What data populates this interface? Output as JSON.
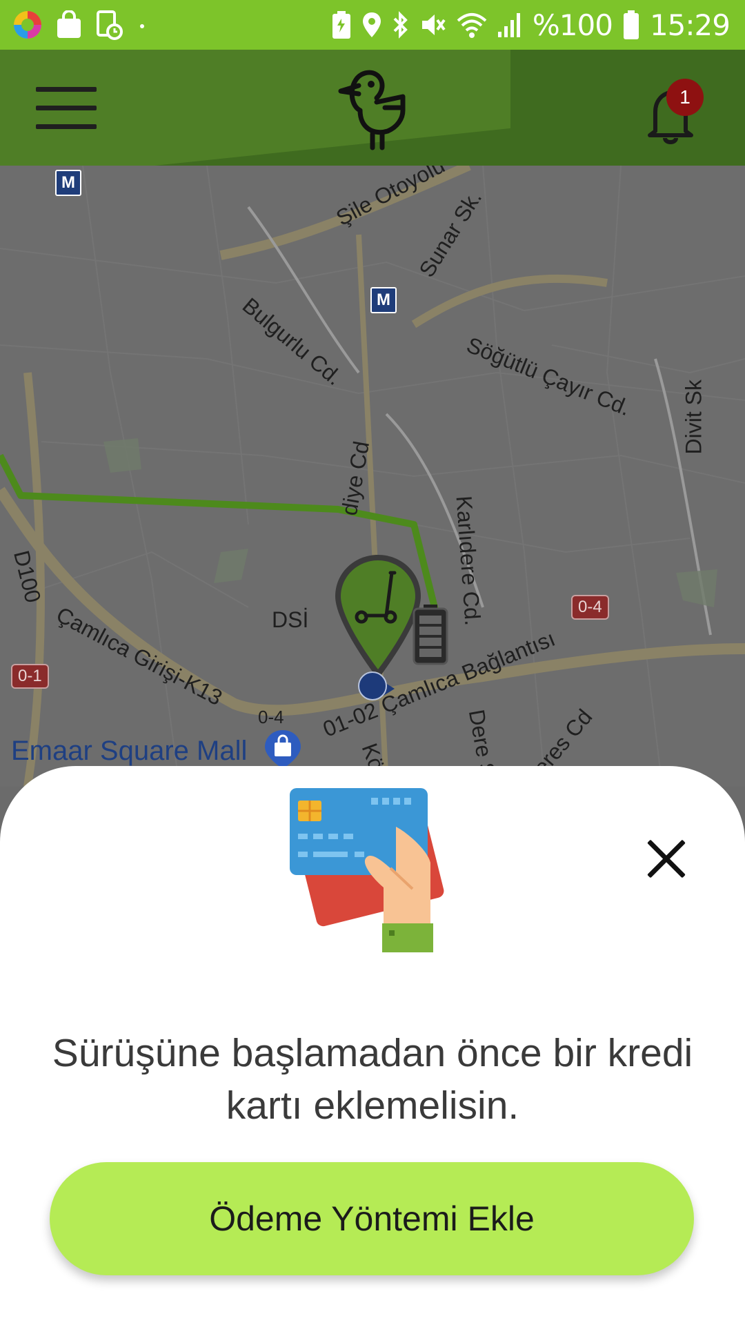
{
  "status_bar": {
    "battery_text": "%100",
    "time": "15:29",
    "left_icons": [
      "multicolor-app-icon",
      "shopping-bag-icon",
      "clock-file-icon",
      "dot-icon"
    ],
    "right_icons": [
      "battery-saver-icon",
      "location-icon",
      "bluetooth-icon",
      "mute-icon",
      "wifi-icon",
      "signal-icon",
      "battery-icon"
    ],
    "background": "#7dc42a"
  },
  "header": {
    "menu_icon": "hamburger-menu-icon",
    "logo_icon": "duck-logo-icon",
    "bell_icon": "bell-icon",
    "notification_count": "1",
    "background": "#3f6b1f"
  },
  "map": {
    "labels": {
      "sile_otoyolu": "Şile Otoyolu",
      "sunar_sk": "Sunar Sk.",
      "bulgurlu_cd": "Bulgurlu Cd.",
      "sogutlu_cayir_cd": "Söğütlü Çayır Cd.",
      "divit_sk": "Divit Sk",
      "diye_cd": "diye Cd",
      "karlidere_cd": "Karlıdere Cd.",
      "d100": "D100",
      "camlica_girisi": "Çamlıca Girişi-K13",
      "dsi": "DSİ",
      "camlica_baglantisi": "01-02 Çamlıca Bağlantısı",
      "o4_a": "0-4",
      "o4_b": "0-4",
      "o1": "0-1",
      "dere_sk": "Dere Sk",
      "eres_cd": "eres Cd",
      "kose": "Köse",
      "metro_a": "M",
      "metro_b": "M"
    },
    "poi": "Emaar Square Mall",
    "pin_icon": "scooter-pin-icon",
    "battery_marker_icon": "battery-level-icon",
    "my_location_icon": "my-location-dot-icon",
    "route_color": "#5fa31a"
  },
  "sheet": {
    "illustration_icon": "credit-card-in-hand-icon",
    "close_icon": "close-icon",
    "message": "Sürüşüne başlamadan önce bir kredi kartı eklemelisin.",
    "button_label": "Ödeme Yöntemi Ekle",
    "button_color": "#b5eb55"
  }
}
